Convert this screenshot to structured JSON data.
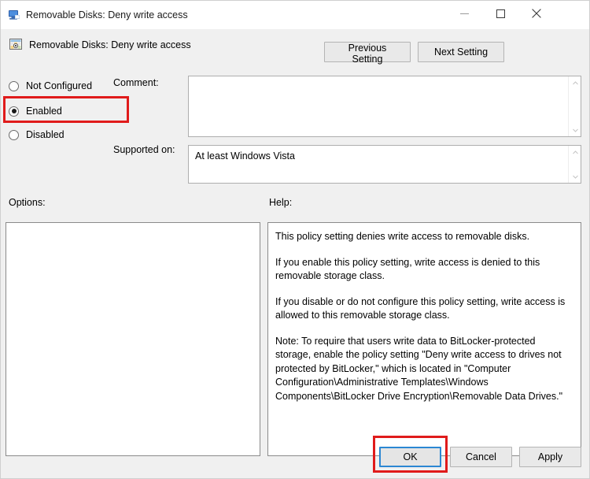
{
  "window": {
    "title": "Removable Disks: Deny write access",
    "title_icon": "monitor-policy-icon",
    "controls": {
      "minimize": "minimize-icon",
      "maximize": "maximize-icon",
      "close": "close-icon"
    }
  },
  "header": {
    "icon": "policy-setting-icon",
    "title": "Removable Disks: Deny write access",
    "previous_label": "Previous Setting",
    "next_label": "Next Setting"
  },
  "state": {
    "options": [
      {
        "label": "Not Configured",
        "selected": false
      },
      {
        "label": "Enabled",
        "selected": true
      },
      {
        "label": "Disabled",
        "selected": false
      }
    ]
  },
  "comment": {
    "label": "Comment:",
    "value": "",
    "placeholder": ""
  },
  "supported": {
    "label": "Supported on:",
    "value": "At least Windows Vista"
  },
  "panels": {
    "options_label": "Options:",
    "help_label": "Help:",
    "options_items": [],
    "help_paragraphs": [
      "This policy setting denies write access to removable disks.",
      "If you enable this policy setting, write access is denied to this removable storage class.",
      "If you disable or do not configure this policy setting, write access is allowed to this removable storage class.",
      "Note: To require that users write data to BitLocker-protected storage, enable the policy setting \"Deny write access to drives not protected by BitLocker,\" which is located in \"Computer Configuration\\Administrative Templates\\Windows Components\\BitLocker Drive Encryption\\Removable Data Drives.\""
    ]
  },
  "footer": {
    "ok_label": "OK",
    "cancel_label": "Cancel",
    "apply_label": "Apply"
  },
  "annotations": {
    "color": "#e01b1b",
    "targets": [
      "Enabled",
      "OK"
    ]
  },
  "focus": {
    "color": "#2b87d3",
    "element": "OK"
  }
}
